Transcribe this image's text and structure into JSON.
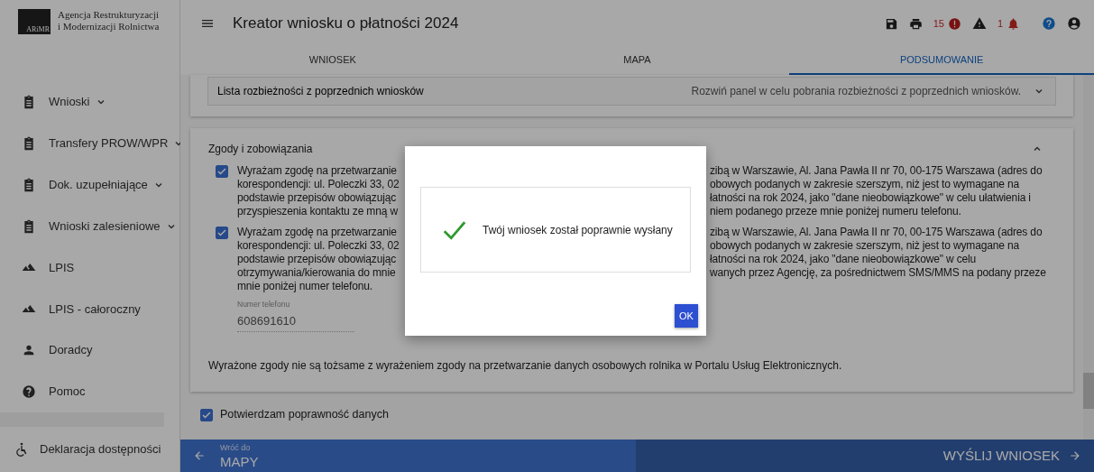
{
  "logo": {
    "lines": [
      "Agencja Restrukturyzacji",
      "i Modernizacji Rolnictwa"
    ],
    "mark_text": "ARiMR"
  },
  "sidebar": {
    "items": [
      {
        "label": "Wnioski",
        "kind": "document",
        "expandable": true
      },
      {
        "label": "Transfery PROW/WPR",
        "kind": "document",
        "expandable": true
      },
      {
        "label": "Dok. uzupełniające",
        "kind": "document",
        "expandable": true
      },
      {
        "label": "Wnioski zalesieniowe",
        "kind": "document",
        "expandable": true
      },
      {
        "label": "LPIS",
        "kind": "map",
        "expandable": false
      },
      {
        "label": "LPIS - całoroczny",
        "kind": "map",
        "expandable": false
      },
      {
        "label": "Doradcy",
        "kind": "person",
        "expandable": false
      },
      {
        "label": "Pomoc",
        "kind": "help",
        "expandable": false
      }
    ],
    "footer_item": {
      "label": "Deklaracja dostępności"
    }
  },
  "header": {
    "title": "Kreator wniosku o płatności 2024",
    "error_count": "15",
    "notification_count": "1"
  },
  "tabs": [
    {
      "label": "WNIOSEK",
      "selected": false
    },
    {
      "label": "MAPA",
      "selected": false
    },
    {
      "label": "PODSUMOWANIE",
      "selected": true
    }
  ],
  "discrepancy_panel": {
    "title": "Lista rozbieżności z poprzednich wniosków",
    "hint": "Rozwiń panel w celu pobrania rozbieżności z poprzednich wniosków.",
    "expanded": false
  },
  "consents_card": {
    "title": "Zgody i zobowiązania",
    "expanded": true,
    "consents": [
      {
        "checked": true,
        "lines": [
          {
            "left": "Wyrażam zgodę na przetwarzanie",
            "right": "zibą w Warszawie, Al. Jana Pawła II nr 70, 00-175 Warszawa (adres do"
          },
          {
            "left": "korespondencji: ul. Poleczki 33, 02",
            "right": "obowych podanych w zakresie szerszym, niż jest to wymagane na"
          },
          {
            "left": "podstawie przepisów obowiązując",
            "right": "łatności na rok 2024, jako \"dane nieobowiązkowe\" w celu ułatwienia i"
          },
          {
            "left": "przyspieszenia kontaktu ze mną w",
            "right": "niem podanego przeze mnie poniżej numeru telefonu."
          }
        ]
      },
      {
        "checked": true,
        "lines": [
          {
            "left": "Wyrażam zgodę na przetwarzanie",
            "right": "zibą w Warszawie, Al. Jana Pawła II nr 70, 00-175 Warszawa (adres do"
          },
          {
            "left": "korespondencji: ul. Poleczki 33, 02",
            "right": "obowych podanych w zakresie szerszym, niż jest to wymagane na"
          },
          {
            "left": "podstawie przepisów obowiązując",
            "right": "łatności na rok 2024, jako \"dane nieobowiązkowe\" w celu"
          },
          {
            "left": "otrzymywania/kierowania do mnie",
            "right": "wanych przez Agencję, za pośrednictwem SMS/MMS na podany przeze"
          },
          {
            "left": "mnie poniżej numer telefonu."
          }
        ]
      }
    ],
    "phone_field": {
      "label": "Numer telefonu",
      "value": "608691610",
      "disabled": true
    },
    "note": "Wyrażone zgody nie są tożsame z wyrażeniem zgody na przetwarzanie danych osobowych rolnika w Portalu Usług Elektronicznych."
  },
  "confirm": {
    "label": "Potwierdzam poprawność danych",
    "checked": true
  },
  "bottom_bar": {
    "back_caption": "Wróć do",
    "back_target": "MAPY",
    "submit": "WYŚLIJ WNIOSEK"
  },
  "dialog": {
    "message": "Twój wniosek został poprawnie wysłany",
    "button": "OK"
  }
}
